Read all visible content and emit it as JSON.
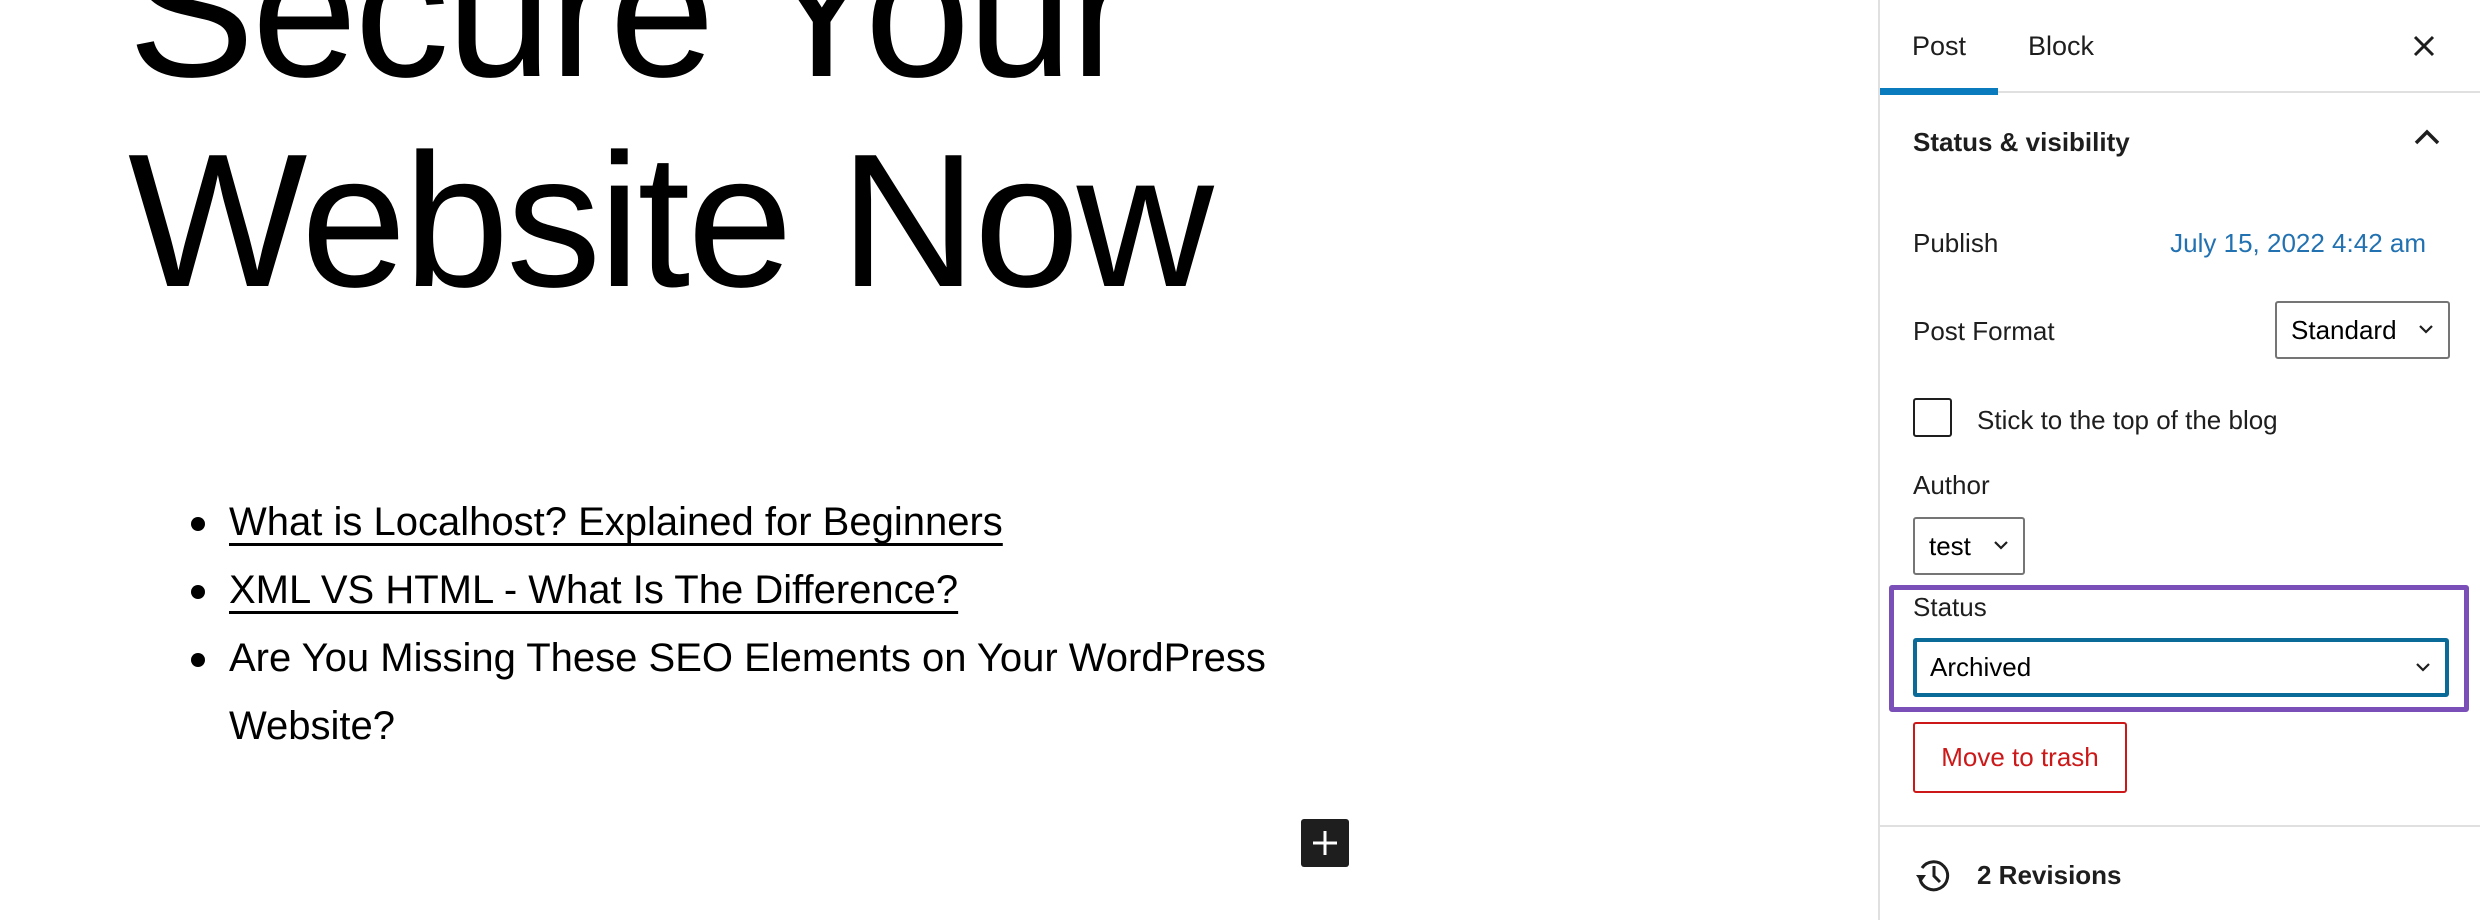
{
  "editor": {
    "title": "Secure Your Website Now",
    "list_items": [
      {
        "text": "What is Localhost? Explained for Beginners",
        "is_link": true
      },
      {
        "text": "XML VS HTML - What Is The Difference?",
        "is_link": true
      },
      {
        "text": "Are You Missing These SEO Elements on Your WordPress Website?",
        "is_link": false
      }
    ],
    "add_block_icon": "plus-icon"
  },
  "sidebar": {
    "tabs": [
      {
        "label": "Post",
        "active": true
      },
      {
        "label": "Block",
        "active": false
      }
    ],
    "close_icon": "close-icon",
    "panel": {
      "title": "Status & visibility",
      "expanded": true,
      "publish_label": "Publish",
      "publish_value": "July 15, 2022 4:42 am",
      "post_format_label": "Post Format",
      "post_format_value": "Standard",
      "sticky_label": "Stick to the top of the blog",
      "sticky_checked": false,
      "author_label": "Author",
      "author_value": "test",
      "status_label": "Status",
      "status_value": "Archived",
      "trash_label": "Move to trash"
    },
    "revisions_label": "2 Revisions"
  },
  "colors": {
    "accent": "#0a7cbd",
    "link": "#2271b1",
    "danger": "#cc1818",
    "highlight": "#7b4fb8",
    "focus_border": "#0a6b99"
  }
}
